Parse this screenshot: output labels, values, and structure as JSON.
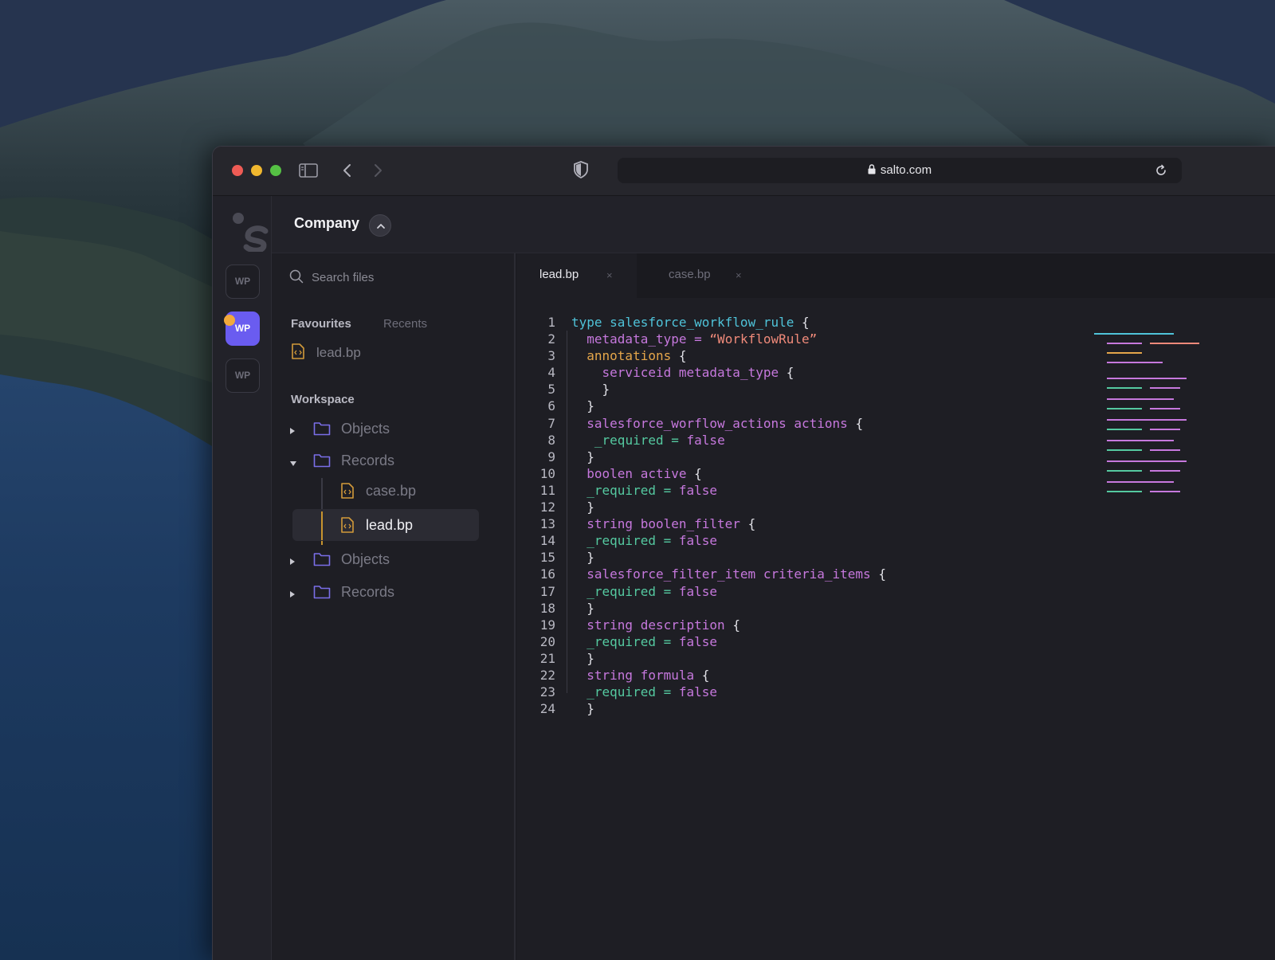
{
  "browser": {
    "url": "salto.com"
  },
  "app": {
    "company": "Company",
    "workspaces": [
      "WP",
      "WP",
      "WP"
    ],
    "search": {
      "placeholder": "Search files"
    },
    "sidebar_tabs": {
      "favourites": "Favourites",
      "recents": "Recents"
    },
    "favourites": [
      {
        "label": "lead.bp"
      }
    ],
    "workspace_title": "Workspace",
    "tree": {
      "objects_1": "Objects",
      "records_1": "Records",
      "files": [
        {
          "label": "case.bp"
        },
        {
          "label": "lead.bp"
        }
      ],
      "objects_2": "Objects",
      "records_2": "Records"
    }
  },
  "editor": {
    "tabs": [
      {
        "label": "lead.bp",
        "close": "×"
      },
      {
        "label": "case.bp",
        "close": "×"
      }
    ],
    "line_numbers": [
      "1",
      "2",
      "3",
      "4",
      "5",
      "6",
      "7",
      "8",
      "9",
      "10",
      "11",
      "12",
      "13",
      "14",
      "15",
      "16",
      "17",
      "18",
      "19",
      "20",
      "21",
      "22",
      "23",
      "24"
    ],
    "code": {
      "l1_kw": "type",
      "l1_name": "salesforce_workflow_rule",
      "l1_brace": "{",
      "l2_key": "metadata_type",
      "l2_eq": "=",
      "l2_val": "“WorkflowRule”",
      "l3_key": "annotations",
      "l3_brace": "{",
      "l4_type": "serviceid",
      "l4_name": "metadata_type",
      "l4_brace": "{",
      "close": "}",
      "l7_type": "salesforce_worflow_actions",
      "l7_name": "actions",
      "l7_brace": "{",
      "req": "_required",
      "eq": "=",
      "false": "false",
      "l10_type": "boolen",
      "l10_name": "active",
      "l13_type": "string",
      "l13_name": "boolen_filter",
      "l16_type": "salesforce_filter_item",
      "l16_name": "criteria_items",
      "l19_type": "string",
      "l19_name": "description",
      "l22_type": "string",
      "l22_name": "formula"
    }
  },
  "colors": {
    "keyword": "#4fc3d9",
    "type": "#c678dd",
    "annotation": "#e5a64a",
    "string": "#f08a7a",
    "required": "#55c9a0",
    "active_workspace": "#6a5cf0",
    "notification_dot": "#f2a93b"
  },
  "icons": [
    "sidebar-toggle-icon",
    "back-arrow-icon",
    "forward-arrow-icon",
    "shield-icon",
    "lock-icon",
    "reload-icon",
    "salto-logo",
    "chevron-up-icon",
    "search-icon",
    "file-code-icon",
    "folder-icon",
    "caret-right-icon",
    "caret-down-icon",
    "close-icon"
  ]
}
